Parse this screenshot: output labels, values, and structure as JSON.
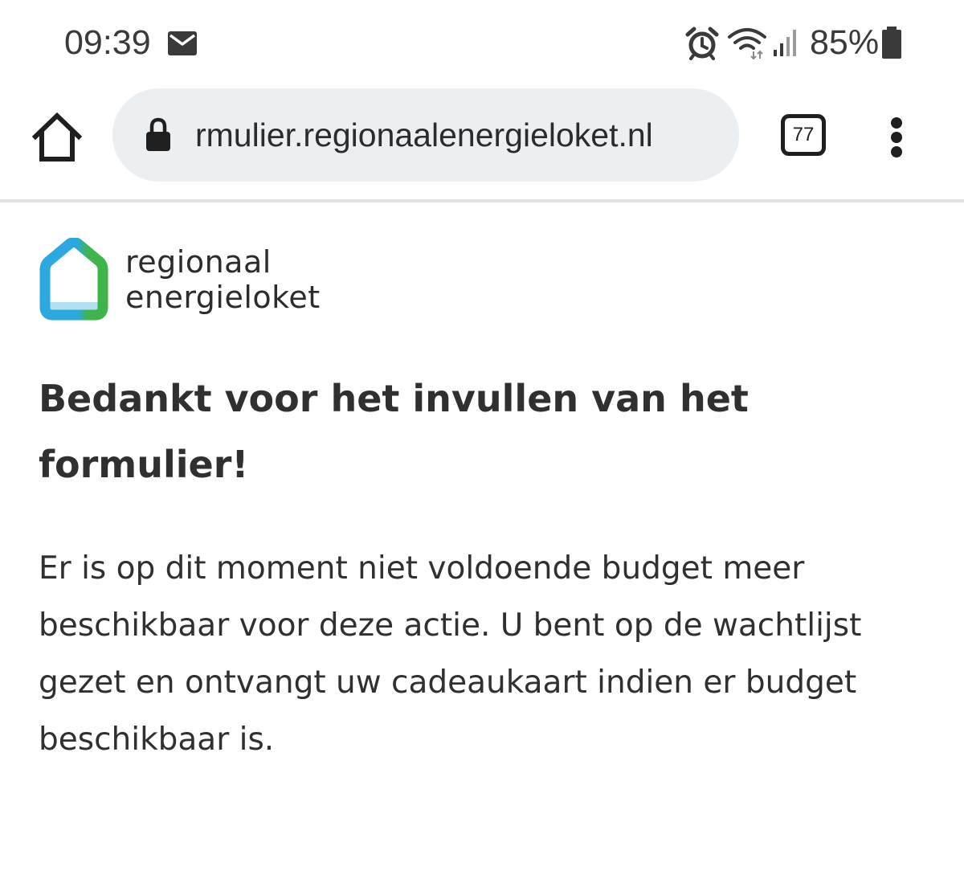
{
  "status_bar": {
    "time": "09:39",
    "battery": "85%",
    "icons": [
      "mail-icon",
      "alarm-icon",
      "wifi-icon",
      "signal-icon",
      "battery-icon"
    ]
  },
  "browser": {
    "url": "rmulier.regionaalenergieloket.nl",
    "tab_count": "77",
    "icons": [
      "home-icon",
      "lock-icon",
      "tabs-icon",
      "menu-icon"
    ]
  },
  "logo": {
    "line1": "regionaal",
    "line2": "energieloket",
    "colors": {
      "blue": "#2aa8df",
      "green": "#3db54a",
      "light_blue": "#b3dff2"
    }
  },
  "content": {
    "title": "Bedankt voor het invullen van het formulier!",
    "message": "Er is op dit moment niet voldoende budget meer beschikbaar voor deze actie. U bent op de wachtlijst gezet en ontvangt uw cadeaukaart indien er budget beschikbaar is."
  }
}
